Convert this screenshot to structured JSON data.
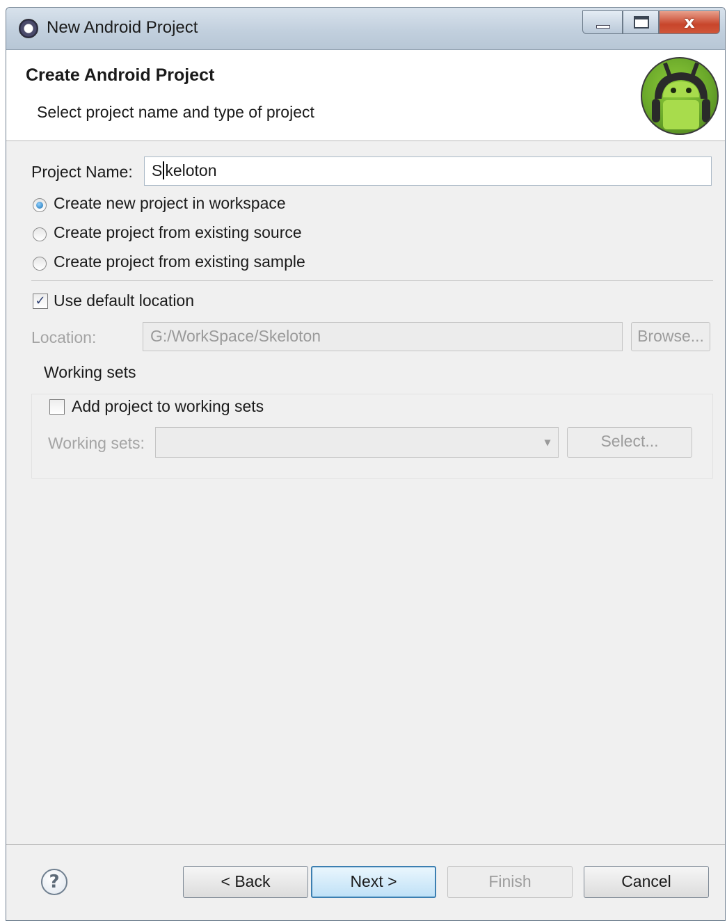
{
  "window": {
    "title": "New Android Project",
    "close_glyph": "x"
  },
  "header": {
    "title": "Create Android Project",
    "subtitle": "Select project name and type of project"
  },
  "project_name": {
    "label": "Project Name:",
    "value_before_caret": "S",
    "value_after_caret": "keloton"
  },
  "project_type": {
    "options": [
      "Create new project in workspace",
      "Create project from existing source",
      "Create project from existing sample"
    ],
    "selected_index": 0
  },
  "location": {
    "use_default_label": "Use default location",
    "use_default_checked": true,
    "check_glyph": "✓",
    "label": "Location:",
    "value": "G:/WorkSpace/Skeloton",
    "browse_label": "Browse..."
  },
  "working_sets": {
    "group_title": "Working sets",
    "add_label": "Add project to working sets",
    "add_checked": false,
    "sets_label": "Working sets:",
    "sets_value": "",
    "select_label": "Select..."
  },
  "footer": {
    "help_glyph": "?",
    "back_label": "< Back",
    "next_label": "Next >",
    "finish_label": "Finish",
    "cancel_label": "Cancel"
  },
  "colors": {
    "titlebar": "#c2d0de",
    "close_button": "#c8452b",
    "android_green": "#6aa82a",
    "primary_button_border": "#3c7fb1"
  }
}
